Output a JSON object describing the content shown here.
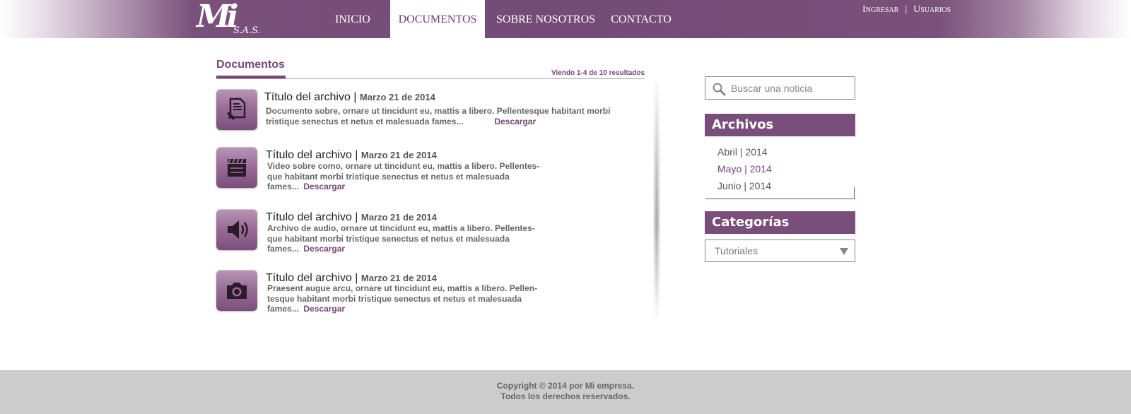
{
  "header": {
    "logo_mark": "Mi",
    "logo_suffix": "S.A.S.",
    "nav": [
      {
        "label": "INICIO"
      },
      {
        "label": "DOCUMENTOS"
      },
      {
        "label": "SOBRE NOSOTROS"
      },
      {
        "label": "CONTACTO"
      }
    ],
    "login": "Ingresar",
    "users": "Usuarios",
    "separator": "|"
  },
  "main": {
    "title": "Documentos",
    "results": "Viendo 1-4 de 10 resultados",
    "items": [
      {
        "icon": "document-pencil-icon",
        "title": "Título del archivo",
        "date": "Marzo 21 de 2014",
        "desc_lines": [
          "Documento sobre, ornare ut tincidunt eu, mattis a libero. Pellentesque habitant morbi",
          "tristique senectus et netus et malesuada fames..."
        ],
        "download": "Descargar"
      },
      {
        "icon": "clapperboard-icon",
        "title": "Título del archivo",
        "date": "Marzo 21 de 2014",
        "desc_lines": [
          "Video sobre como, ornare ut tincidunt eu, mattis a libero. Pellentes-",
          "que habitant morbi tristique senectus et netus et malesuada",
          "fames..."
        ],
        "download": "Descargar"
      },
      {
        "icon": "speaker-icon",
        "title": "Título del archivo",
        "date": "Marzo 21 de 2014",
        "desc_lines": [
          "Archivo de audio, ornare ut tincidunt eu, mattis a libero. Pellentes-",
          "que habitant morbi tristique senectus et netus et malesuada",
          "fames..."
        ],
        "download": "Descargar"
      },
      {
        "icon": "camera-icon",
        "title": "Título del archivo",
        "date": "Marzo 21 de 2014",
        "desc_lines": [
          "Praesent augue arcu, ornare ut tincidunt eu, mattis a libero. Pellen-",
          "tesque habitant morbi tristique senectus et netus et malesuada",
          "fames..."
        ],
        "download": "Descargar"
      }
    ]
  },
  "sidebar": {
    "search_placeholder": "Buscar una noticia",
    "archives_title": "Archivos",
    "archives": [
      {
        "label": "Abril | 2014"
      },
      {
        "label": "Mayo | 2014"
      },
      {
        "label": "Junio | 2014"
      }
    ],
    "categories_title": "Categorías",
    "category_selected": "Tutoriales"
  },
  "footer": {
    "line1": "Copyright © 2014 por Mi empresa.",
    "line2": "Todos los derechos reservados."
  },
  "colors": {
    "brand": "#774776",
    "header": "#744a76",
    "footer": "#cccccc"
  }
}
